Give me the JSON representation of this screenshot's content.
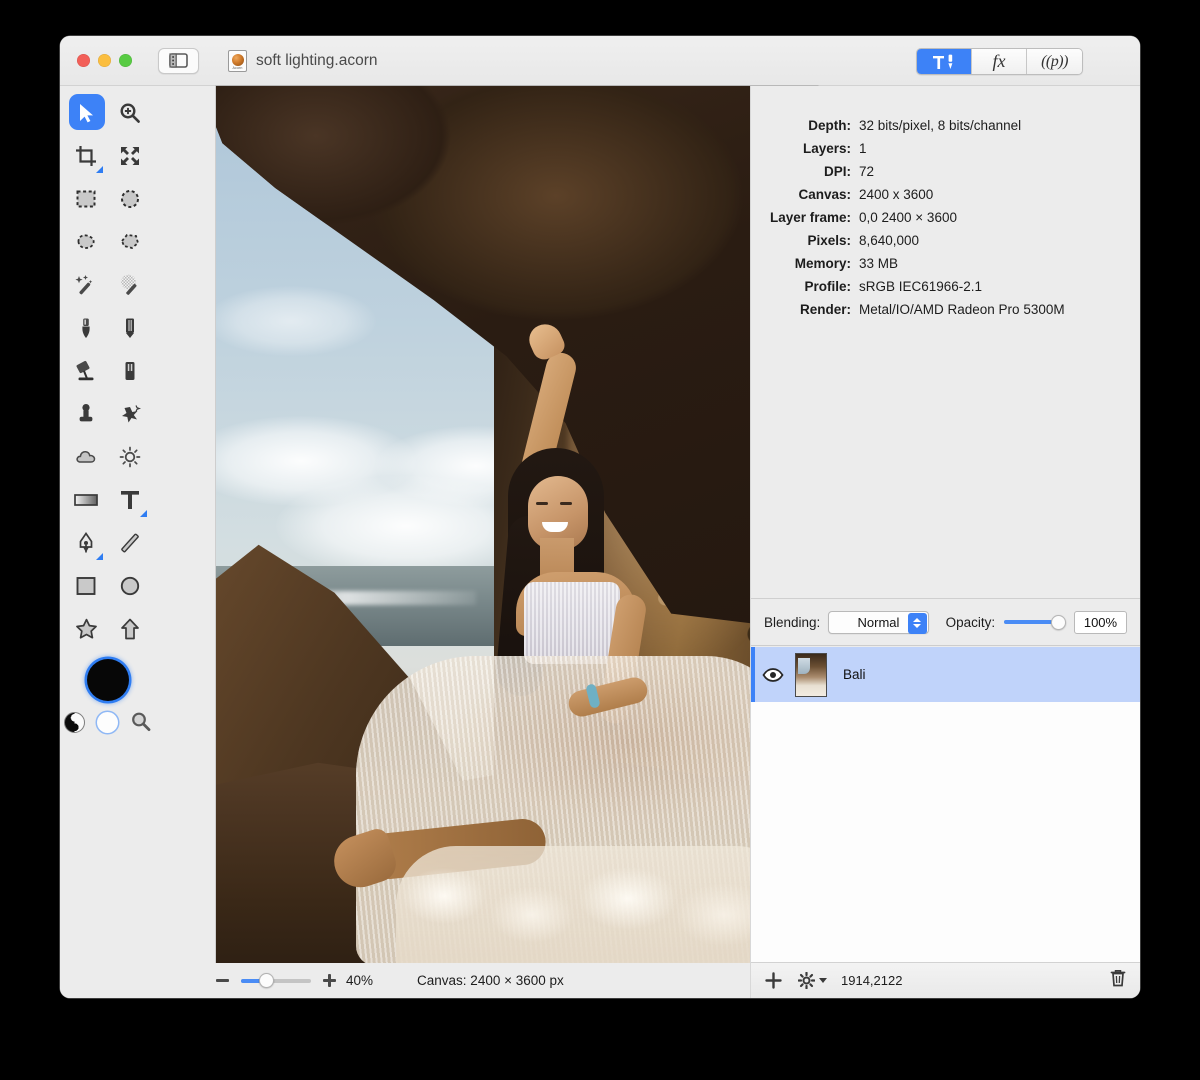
{
  "window": {
    "title": "soft lighting.acorn",
    "doc_icon_label": "Acorn",
    "traffic_lights": [
      "close",
      "minimize",
      "zoom"
    ]
  },
  "toolbar": {
    "sidebar_toggle": "sidebar-toggle",
    "segments": [
      {
        "id": "tools-inspector",
        "label": "",
        "icon": "hammer-brush-icon",
        "active": true
      },
      {
        "id": "filters-inspector",
        "label": "fx",
        "icon": "fx-icon",
        "active": false
      },
      {
        "id": "palette-inspector",
        "label": "((p))",
        "icon": "presets-icon",
        "active": false
      }
    ]
  },
  "tools": {
    "items": [
      {
        "name": "move-tool",
        "selected": true
      },
      {
        "name": "zoom-tool",
        "selected": false
      },
      {
        "name": "crop-tool",
        "selected": false,
        "corner": true
      },
      {
        "name": "transform-tool",
        "selected": false
      },
      {
        "name": "rectangle-select-tool",
        "selected": false
      },
      {
        "name": "ellipse-select-tool",
        "selected": false
      },
      {
        "name": "lasso-select-tool",
        "selected": false
      },
      {
        "name": "polygon-select-tool",
        "selected": false
      },
      {
        "name": "magic-wand-tool",
        "selected": false
      },
      {
        "name": "instant-alpha-tool",
        "selected": false
      },
      {
        "name": "paint-brush-tool",
        "selected": false
      },
      {
        "name": "pencil-tool",
        "selected": false
      },
      {
        "name": "paint-bucket-tool",
        "selected": false
      },
      {
        "name": "eraser-tool",
        "selected": false
      },
      {
        "name": "clone-stamp-tool",
        "selected": false
      },
      {
        "name": "smudge-tool",
        "selected": false
      },
      {
        "name": "blur-tool",
        "selected": false
      },
      {
        "name": "dodge-burn-tool",
        "selected": false
      },
      {
        "name": "gradient-tool",
        "selected": false,
        "corner": true
      },
      {
        "name": "text-tool",
        "selected": false,
        "corner": true
      },
      {
        "name": "bezier-pen-tool",
        "selected": false,
        "corner": true
      },
      {
        "name": "line-tool",
        "selected": false
      },
      {
        "name": "rectangle-shape-tool",
        "selected": false
      },
      {
        "name": "ellipse-shape-tool",
        "selected": false
      },
      {
        "name": "star-shape-tool",
        "selected": false
      },
      {
        "name": "arrow-shape-tool",
        "selected": false
      }
    ],
    "color_well": "#070707",
    "accent": "#3d82f7"
  },
  "info": {
    "rows": [
      {
        "key": "Depth:",
        "value": "32 bits/pixel, 8 bits/channel"
      },
      {
        "key": "Layers:",
        "value": "1"
      },
      {
        "key": "DPI:",
        "value": "72"
      },
      {
        "key": "Canvas:",
        "value": "2400 x 3600"
      },
      {
        "key": "Layer frame:",
        "value": "0,0 2400 × 3600"
      },
      {
        "key": "Pixels:",
        "value": "8,640,000"
      },
      {
        "key": "Memory:",
        "value": "33 MB"
      },
      {
        "key": "Profile:",
        "value": "sRGB IEC61966-2.1"
      },
      {
        "key": "Render:",
        "value": "Metal/IO/AMD Radeon Pro 5300M"
      }
    ]
  },
  "blending": {
    "label": "Blending:",
    "mode": "Normal",
    "options": [
      "Normal"
    ],
    "opacity_label": "Opacity:",
    "opacity_value": "100%",
    "opacity_percent": 100
  },
  "layers": {
    "rows": [
      {
        "name": "Bali",
        "visible": true,
        "selected": true
      }
    ],
    "footer": {
      "add": "+",
      "coords": "1914,2122",
      "gear": "gear-icon",
      "trash": "trash-icon"
    }
  },
  "statusbar": {
    "zoom_percent": "40%",
    "zoom_value": 40,
    "canvas_size": "Canvas: 2400 × 3600 px"
  }
}
